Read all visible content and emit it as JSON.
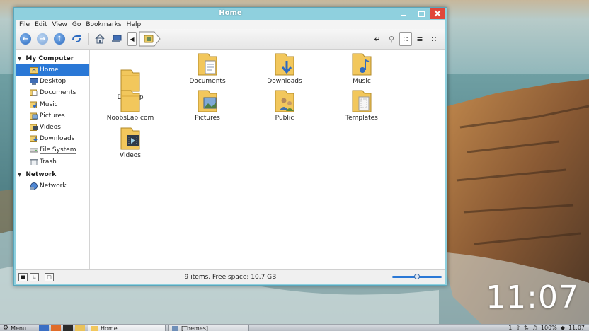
{
  "window": {
    "title": "Home"
  },
  "menubar": {
    "items": [
      "File",
      "Edit",
      "View",
      "Go",
      "Bookmarks",
      "Help"
    ]
  },
  "toolbar": {
    "icons": [
      "back-icon",
      "forward-icon",
      "up-icon",
      "reload-icon",
      "home-icon",
      "computer-icon"
    ],
    "view_modes": [
      "icon-view",
      "list-view",
      "compact-view"
    ]
  },
  "sidebar": {
    "sections": [
      {
        "title": "My Computer",
        "items": [
          {
            "label": "Home",
            "icon": "home-folder-icon",
            "selected": true
          },
          {
            "label": "Desktop",
            "icon": "desktop-icon"
          },
          {
            "label": "Documents",
            "icon": "documents-icon"
          },
          {
            "label": "Music",
            "icon": "music-icon"
          },
          {
            "label": "Pictures",
            "icon": "pictures-icon"
          },
          {
            "label": "Videos",
            "icon": "videos-icon"
          },
          {
            "label": "Downloads",
            "icon": "downloads-icon"
          },
          {
            "label": "File System",
            "icon": "drive-icon"
          },
          {
            "label": "Trash",
            "icon": "trash-icon"
          }
        ]
      },
      {
        "title": "Network",
        "items": [
          {
            "label": "Network",
            "icon": "network-icon"
          }
        ]
      }
    ]
  },
  "files": [
    {
      "label": "Desktop",
      "emblem": "none"
    },
    {
      "label": "Documents",
      "emblem": "document"
    },
    {
      "label": "Downloads",
      "emblem": "download"
    },
    {
      "label": "Music",
      "emblem": "music"
    },
    {
      "label": "NoobsLab.com",
      "emblem": "none"
    },
    {
      "label": "Pictures",
      "emblem": "pictures"
    },
    {
      "label": "Public",
      "emblem": "public"
    },
    {
      "label": "Templates",
      "emblem": "templates"
    },
    {
      "label": "Videos",
      "emblem": "videos"
    }
  ],
  "statusbar": {
    "text": "9 items, Free space: 10.7 GB",
    "zoom_level": 0.5
  },
  "desktop": {
    "clock": "11:07"
  },
  "taskbar": {
    "menu_label": "Menu",
    "tasks": [
      "Home",
      "[Themes]"
    ],
    "tray": {
      "battery": "100%",
      "time": "11:07",
      "workspace": "1"
    }
  },
  "colors": {
    "selection": "#2a78d6",
    "title_bar": "#8fd0de",
    "close_button": "#e0463a",
    "folder": "#f2c75c"
  }
}
